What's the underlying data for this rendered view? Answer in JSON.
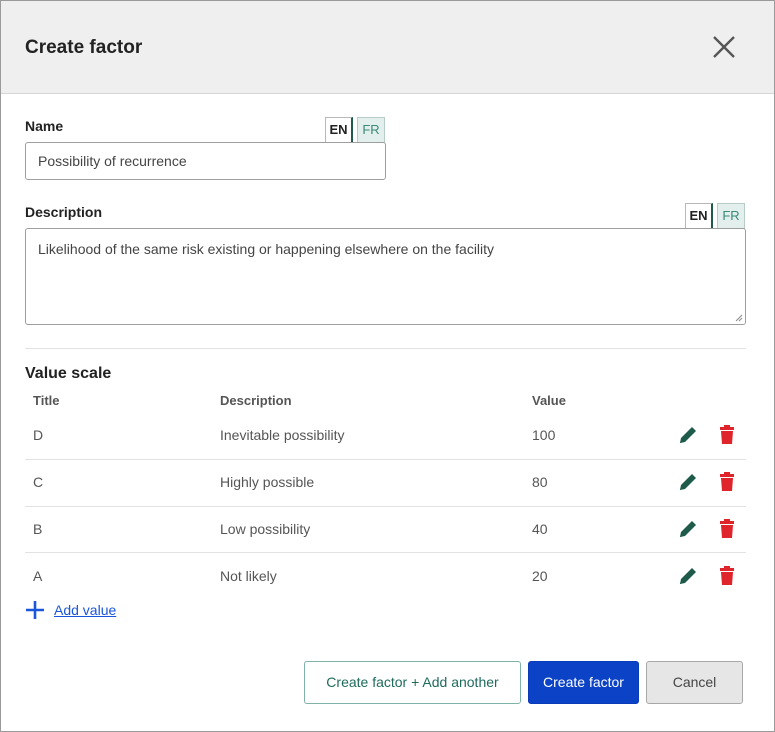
{
  "dialog": {
    "title": "Create factor",
    "close_icon": "close-icon"
  },
  "name_field": {
    "label": "Name",
    "value": "Possibility of recurrence",
    "lang_tabs": [
      "EN",
      "FR"
    ],
    "active_lang": "EN"
  },
  "description_field": {
    "label": "Description",
    "value": "Likelihood of the same risk existing or happening elsewhere on the facility",
    "lang_tabs": [
      "EN",
      "FR"
    ],
    "active_lang": "EN"
  },
  "value_scale": {
    "title": "Value scale",
    "columns": [
      "Title",
      "Description",
      "Value"
    ],
    "rows": [
      {
        "title": "D",
        "description": "Inevitable possibility",
        "value": "100"
      },
      {
        "title": "C",
        "description": "Highly possible",
        "value": "80"
      },
      {
        "title": "B",
        "description": "Low possibility",
        "value": "40"
      },
      {
        "title": "A",
        "description": "Not likely",
        "value": "20"
      }
    ],
    "edit_icon": "pencil-icon",
    "delete_icon": "trash-icon",
    "add_label": "Add value"
  },
  "footer": {
    "create_another_label": "Create factor + Add another",
    "create_label": "Create factor",
    "cancel_label": "Cancel"
  },
  "colors": {
    "primary": "#0b42c6",
    "edit_icon": "#1f5b4a",
    "delete_icon": "#e0242b",
    "link": "#1a56db"
  }
}
